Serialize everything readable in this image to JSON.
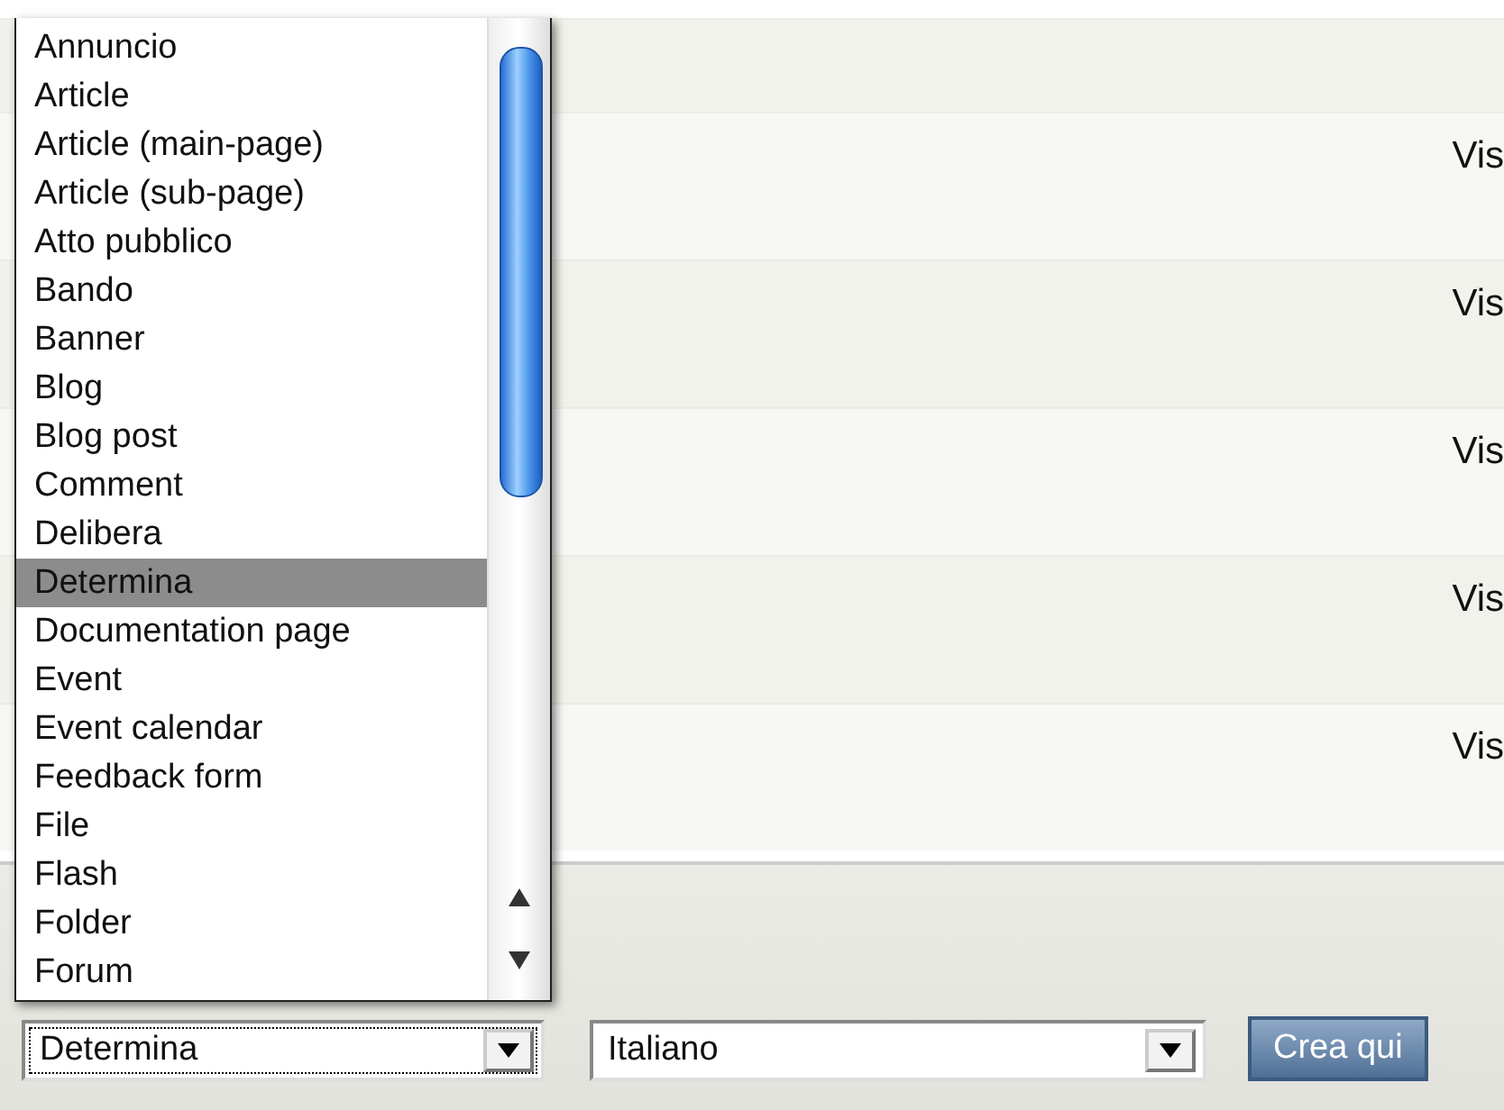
{
  "rows": [
    {
      "status": "Vis"
    },
    {
      "status": "Vis"
    },
    {
      "status": "Vis"
    },
    {
      "status": "Vis"
    },
    {
      "status": "Vis"
    }
  ],
  "type_select": {
    "value": "Determina",
    "expanded": true,
    "options": [
      {
        "label": "Annuncio",
        "selected": false
      },
      {
        "label": "Article",
        "selected": false
      },
      {
        "label": "Article (main-page)",
        "selected": false
      },
      {
        "label": "Article (sub-page)",
        "selected": false
      },
      {
        "label": "Atto pubblico",
        "selected": false
      },
      {
        "label": "Bando",
        "selected": false
      },
      {
        "label": "Banner",
        "selected": false
      },
      {
        "label": "Blog",
        "selected": false
      },
      {
        "label": "Blog post",
        "selected": false
      },
      {
        "label": "Comment",
        "selected": false
      },
      {
        "label": "Delibera",
        "selected": false
      },
      {
        "label": "Determina",
        "selected": true
      },
      {
        "label": "Documentation page",
        "selected": false
      },
      {
        "label": "Event",
        "selected": false
      },
      {
        "label": "Event calendar",
        "selected": false
      },
      {
        "label": "Feedback form",
        "selected": false
      },
      {
        "label": "File",
        "selected": false
      },
      {
        "label": "Flash",
        "selected": false
      },
      {
        "label": "Folder",
        "selected": false
      },
      {
        "label": "Forum",
        "selected": false
      }
    ]
  },
  "language_select": {
    "value": "Italiano"
  },
  "create_button": {
    "label": "Crea qui"
  }
}
